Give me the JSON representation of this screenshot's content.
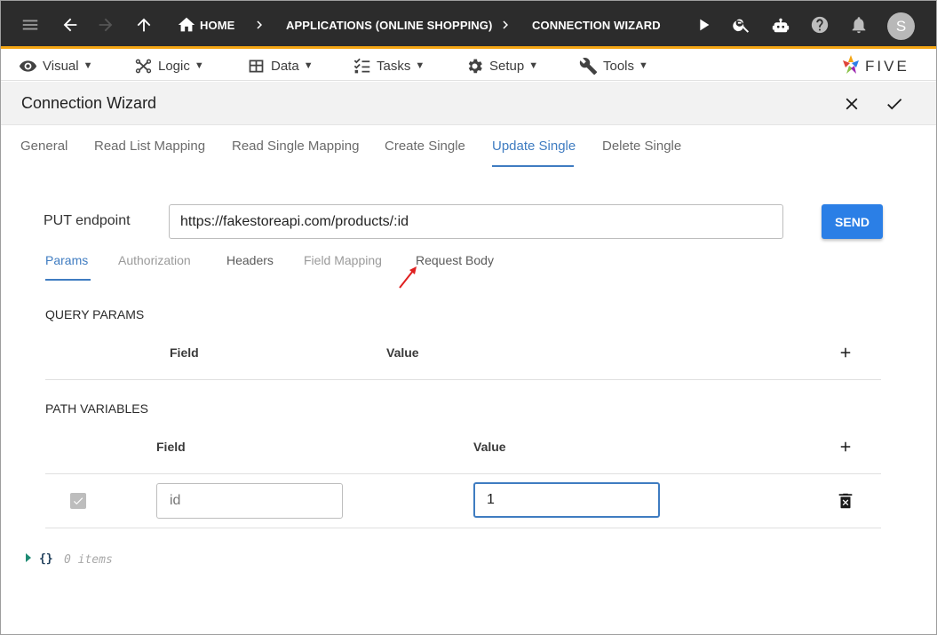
{
  "topbar": {
    "breadcrumb": [
      {
        "label": "HOME"
      },
      {
        "label": "APPLICATIONS (ONLINE SHOPPING)"
      },
      {
        "label": "CONNECTION WIZARD"
      }
    ],
    "avatar_initial": "S",
    "accent_color": "#f4a614"
  },
  "menu": {
    "items": [
      {
        "label": "Visual",
        "icon": "eye-icon"
      },
      {
        "label": "Logic",
        "icon": "flow-icon"
      },
      {
        "label": "Data",
        "icon": "table-icon"
      },
      {
        "label": "Tasks",
        "icon": "checklist-icon"
      },
      {
        "label": "Setup",
        "icon": "gear-icon"
      },
      {
        "label": "Tools",
        "icon": "tools-icon"
      }
    ],
    "caret": "▼",
    "logo_text": "FIVE"
  },
  "page": {
    "title": "Connection Wizard"
  },
  "tabs": [
    {
      "label": "General"
    },
    {
      "label": "Read List Mapping"
    },
    {
      "label": "Read Single Mapping"
    },
    {
      "label": "Create Single"
    },
    {
      "label": "Update Single",
      "active": true
    },
    {
      "label": "Delete Single"
    }
  ],
  "endpoint": {
    "label": "PUT endpoint",
    "value": "https://fakestoreapi.com/products/:id",
    "send_label": "SEND"
  },
  "subtabs": [
    {
      "label": "Params",
      "active": true
    },
    {
      "label": "Authorization"
    },
    {
      "label": "Headers"
    },
    {
      "label": "Field Mapping"
    },
    {
      "label": "Request Body"
    }
  ],
  "query_params": {
    "heading": "QUERY PARAMS",
    "field_header": "Field",
    "value_header": "Value"
  },
  "path_variables": {
    "heading": "PATH VARIABLES",
    "field_header": "Field",
    "value_header": "Value",
    "rows": [
      {
        "field_placeholder": "id",
        "value": "1",
        "checked": true
      }
    ]
  },
  "json_viewer": {
    "braces": "{}",
    "count": "0 items"
  },
  "colors": {
    "active_tab": "#3f7cc1",
    "send_button": "#2b7fe6",
    "annotation_arrow": "#e02020"
  }
}
